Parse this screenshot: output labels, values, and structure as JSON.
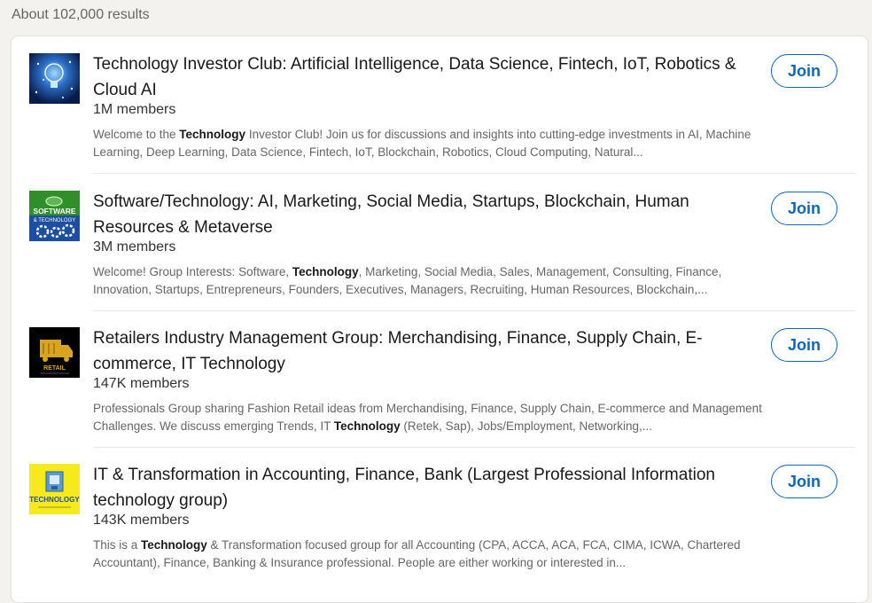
{
  "results_count": "About 102,000 results",
  "groups": [
    {
      "title": "Technology Investor Club: Artificial Intelligence, Data Science, Fintech, IoT, Robotics & Cloud AI",
      "members": "1M members",
      "desc_before": "Welcome to the ",
      "desc_highlight": "Technology",
      "desc_after": " Investor Club! Join us for discussions and insights into cutting-edge investments in AI, Machine Learning, Deep Learning, Data Science, Fintech, IoT, Blockchain, Robotics, Cloud Computing, Natural...",
      "join_label": "Join"
    },
    {
      "title": "Software/Technology: AI, Marketing, Social Media, Startups, Blockchain, Human Resources & Metaverse",
      "members": "3M members",
      "desc_before": "Welcome! Group Interests: Software, ",
      "desc_highlight": "Technology",
      "desc_after": ", Marketing, Social Media, Sales, Management, Consulting, Finance, Innovation, Startups, Entrepreneurs, Founders, Executives, Managers, Recruiting, Human Resources, Blockchain,...",
      "join_label": "Join",
      "logo_text_1": "SOFTWARE",
      "logo_text_2": "& TECHNOLOGY"
    },
    {
      "title": "Retailers Industry Management Group: Merchandising, Finance, Supply Chain, E-commerce, IT Technology",
      "members": "147K members",
      "desc_before": "Professionals Group sharing Fashion Retail ideas from Merchandising, Finance, Supply Chain, E-commerce and Management Challenges. We discuss emerging Trends, IT ",
      "desc_highlight": "Technology",
      "desc_after": " (Retek, Sap), Jobs/Employment, Networking,...",
      "join_label": "Join",
      "logo_text_1": "RETAIL"
    },
    {
      "title": "IT & Transformation in Accounting, Finance, Bank (Largest Professional Information technology group)",
      "members": "143K members",
      "desc_before": "This is a ",
      "desc_highlight": "Technology",
      "desc_after": " & Transformation focused group for all Accounting (CPA, ACCA, ACA, FCA, CIMA, ICWA, Chartered Accountant), Finance, Banking & Insurance professional. People are either working or interested in...",
      "join_label": "Join",
      "logo_text_1": "TECHNOLOGY"
    }
  ],
  "colors": {
    "accent": "#0a66c2",
    "background": "#f4f2ee",
    "card": "#ffffff"
  }
}
